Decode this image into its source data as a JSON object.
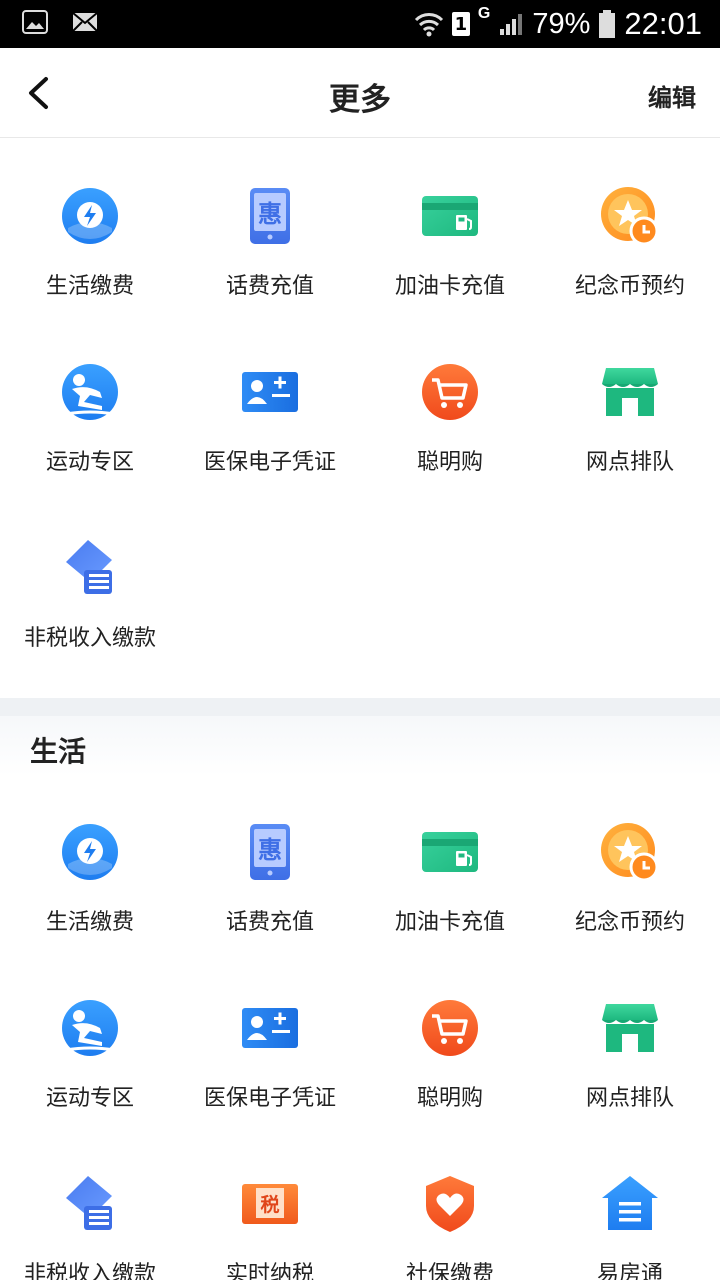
{
  "status_bar": {
    "left_icons": [
      "image-icon",
      "mail-icon"
    ],
    "sim_slot": "1",
    "network": "G",
    "battery": "79%",
    "time": "22:01"
  },
  "header": {
    "title": "更多",
    "edit_label": "编辑"
  },
  "top_section": {
    "items": [
      {
        "label": "生活缴费",
        "icon": "bolt-icon"
      },
      {
        "label": "话费充值",
        "icon": "phone-hui-icon"
      },
      {
        "label": "加油卡充值",
        "icon": "fuel-card-icon"
      },
      {
        "label": "纪念币预约",
        "icon": "coin-clock-icon"
      },
      {
        "label": "运动专区",
        "icon": "skater-icon"
      },
      {
        "label": "医保电子凭证",
        "icon": "medical-card-icon"
      },
      {
        "label": "聪明购",
        "icon": "cart-icon"
      },
      {
        "label": "网点排队",
        "icon": "branch-store-icon"
      },
      {
        "label": "非税收入缴款",
        "icon": "nontax-icon"
      }
    ]
  },
  "life_section": {
    "title": "生活",
    "items": [
      {
        "label": "生活缴费",
        "icon": "bolt-icon"
      },
      {
        "label": "话费充值",
        "icon": "phone-hui-icon"
      },
      {
        "label": "加油卡充值",
        "icon": "fuel-card-icon"
      },
      {
        "label": "纪念币预约",
        "icon": "coin-clock-icon"
      },
      {
        "label": "运动专区",
        "icon": "skater-icon"
      },
      {
        "label": "医保电子凭证",
        "icon": "medical-card-icon"
      },
      {
        "label": "聪明购",
        "icon": "cart-icon"
      },
      {
        "label": "网点排队",
        "icon": "branch-store-icon"
      },
      {
        "label": "非税收入缴款",
        "icon": "nontax-icon"
      },
      {
        "label": "实时纳税",
        "icon": "tax-icon",
        "icon_text": "税"
      },
      {
        "label": "社保缴费",
        "icon": "social-security-icon"
      },
      {
        "label": "易房通",
        "icon": "house-icon"
      }
    ]
  }
}
